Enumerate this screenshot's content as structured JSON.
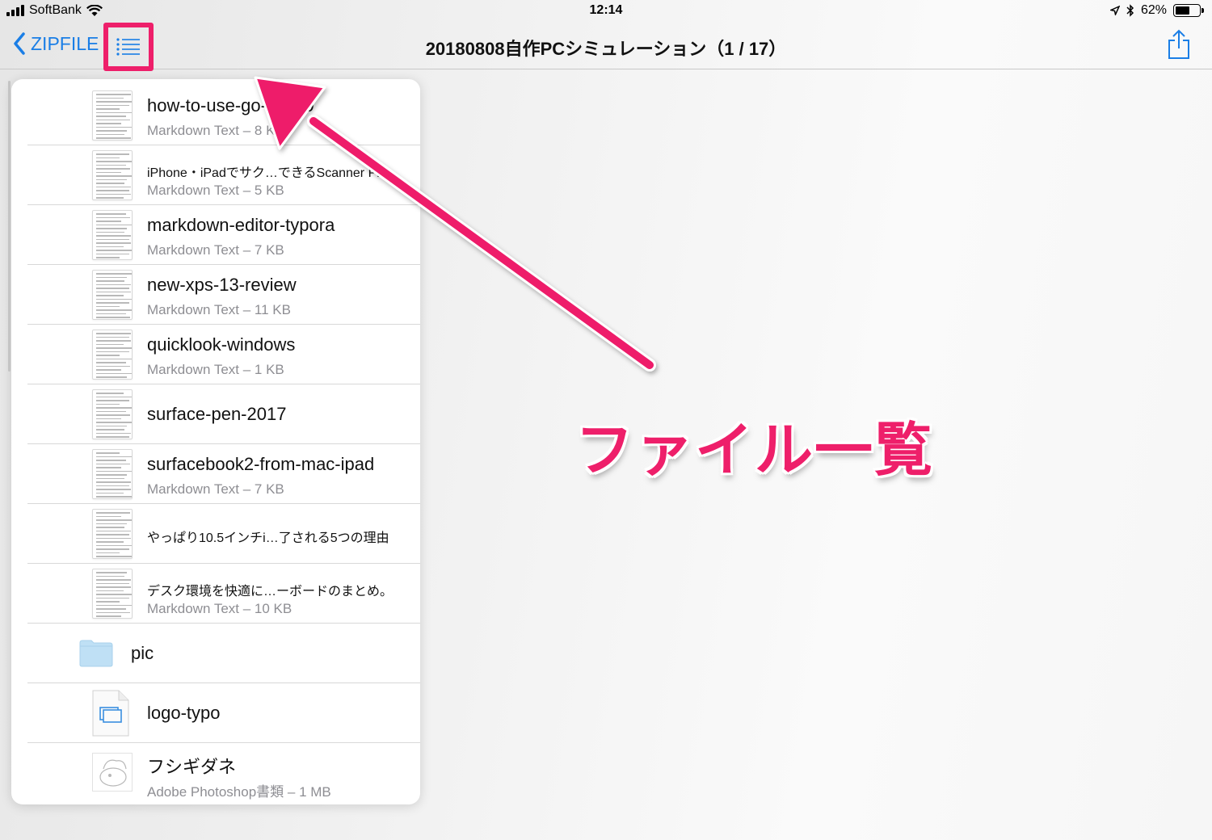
{
  "status": {
    "carrier": "SoftBank",
    "time": "12:14",
    "battery": "62%",
    "battery_level": 0.62,
    "icons": [
      "signal-icon",
      "wifi-icon",
      "location-icon",
      "bluetooth-icon",
      "battery-icon"
    ]
  },
  "nav": {
    "back_label": "ZIPFILE",
    "title": "20180808自作PCシミュレーション（1 / 17）",
    "list_icon": "list-icon",
    "share_icon": "share-icon"
  },
  "files": [
    {
      "name": "how-to-use-go-kit350",
      "meta": "Markdown Text – 8 KB"
    },
    {
      "name": "iPhone・iPadでサク…できるScanner Pro",
      "meta": "Markdown Text – 5 KB"
    },
    {
      "name": "markdown-editor-typora",
      "meta": "Markdown Text – 7 KB"
    },
    {
      "name": "new-xps-13-review",
      "meta": "Markdown Text – 11 KB"
    },
    {
      "name": "quicklook-windows",
      "meta": "Markdown Text – 1 KB"
    },
    {
      "name": "surface-pen-2017",
      "meta": ""
    },
    {
      "name": "surfacebook2-from-mac-ipad",
      "meta": "Markdown Text – 7 KB"
    },
    {
      "name": "やっぱり10.5インチi…了される5つの理由",
      "meta": ""
    },
    {
      "name": "デスク環境を快適に…ーボードのまとめ。",
      "meta": "Markdown Text – 10 KB"
    }
  ],
  "folder": {
    "name": "pic"
  },
  "image_file": {
    "name": "logo-typo"
  },
  "psd_file": {
    "name": "フシギダネ",
    "meta": "Adobe Photoshop書類 – 1 MB"
  },
  "annotation": {
    "text": "ファイル一覧"
  },
  "colors": {
    "accent": "#ee1f6a",
    "link": "#1a7ee6",
    "secondary": "#8e8e93"
  }
}
